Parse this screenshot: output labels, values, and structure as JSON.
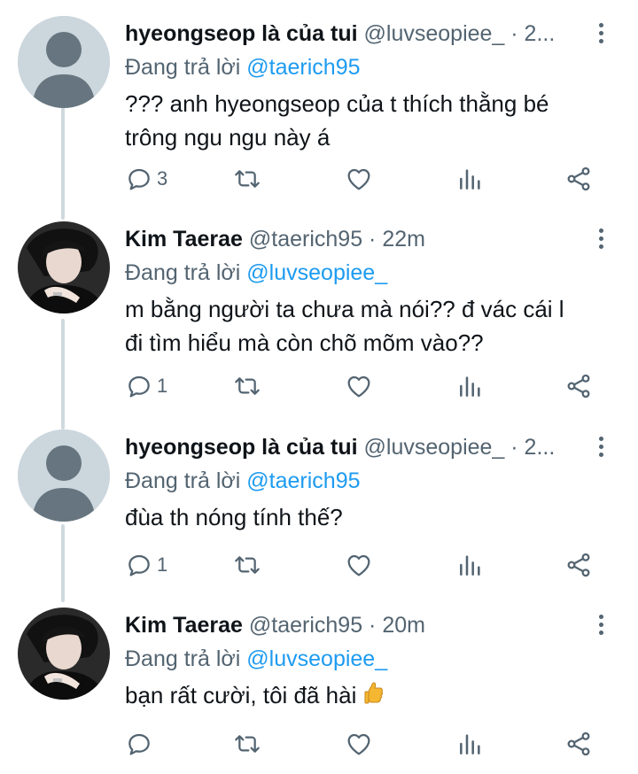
{
  "thread": {
    "replying_prefix": "Đang trả lời",
    "tweets": [
      {
        "author_name": "hyeongseop là của tui",
        "author_handle": "@luvseopiee_ · 2...",
        "reply_to": "@taerich95",
        "text": "??? anh hyeongseop của t thích thằng bé\ntrông ngu ngu này á",
        "reply_count": "3",
        "avatar": "default-avatar"
      },
      {
        "author_name": "Kim Taerae",
        "author_handle": "@taerich95 · 22m",
        "reply_to": "@luvseopiee_",
        "text": "m bằng người ta chưa mà nói?? đ vác cái l\nđi tìm hiểu mà còn chõ mõm vào??",
        "reply_count": "1",
        "avatar": "profile-photo"
      },
      {
        "author_name": "hyeongseop là của tui",
        "author_handle": "@luvseopiee_ · 2...",
        "reply_to": "@taerich95",
        "text": "đùa th nóng tính thế?",
        "reply_count": "1",
        "avatar": "default-avatar"
      },
      {
        "author_name": "Kim Taerae",
        "author_handle": "@taerich95 · 20m",
        "reply_to": "@luvseopiee_",
        "text": "bạn rất cười, tôi đã hài",
        "reply_count": "",
        "avatar": "profile-photo",
        "emoji": "thumbs-up"
      }
    ]
  },
  "colors": {
    "accent": "#1d9bf0",
    "muted": "#536471",
    "thread_line": "#cfd9de"
  },
  "icons": [
    "reply-icon",
    "retweet-icon",
    "like-icon",
    "analytics-icon",
    "share-icon",
    "more-icon"
  ]
}
